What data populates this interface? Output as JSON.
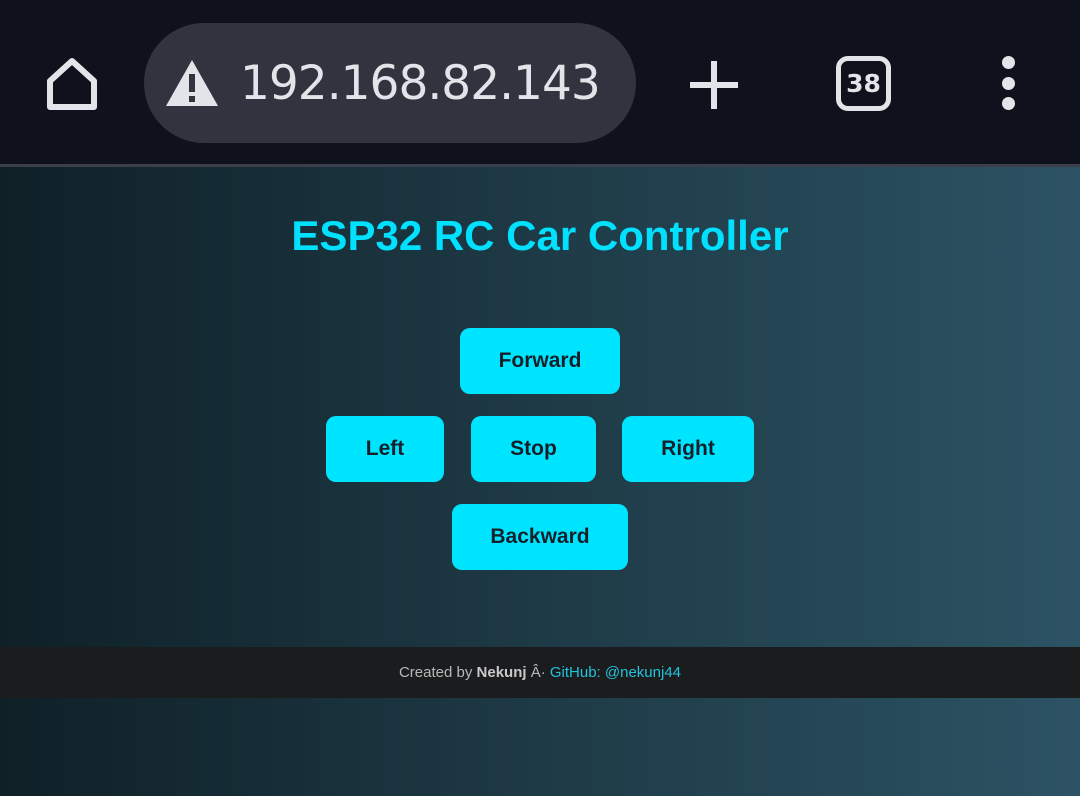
{
  "browser": {
    "url": "192.168.82.143",
    "tab_count": "38",
    "icons": {
      "home": "home-icon",
      "security": "warning-icon",
      "new_tab": "plus-icon",
      "menu": "more-vert-icon"
    }
  },
  "page": {
    "title": "ESP32 RC Car Controller",
    "controls": {
      "forward": "Forward",
      "left": "Left",
      "stop": "Stop",
      "right": "Right",
      "backward": "Backward"
    },
    "footer": {
      "prefix": "Created by ",
      "author": "Nekunj",
      "separator": " Â· ",
      "link_text": "GitHub: @nekunj44"
    }
  },
  "colors": {
    "accent": "#00e5ff",
    "title": "#00e0ff",
    "chrome_bg": "#0f121c",
    "url_bar_bg": "#31343f",
    "footer_bg": "#1b1c1e"
  }
}
